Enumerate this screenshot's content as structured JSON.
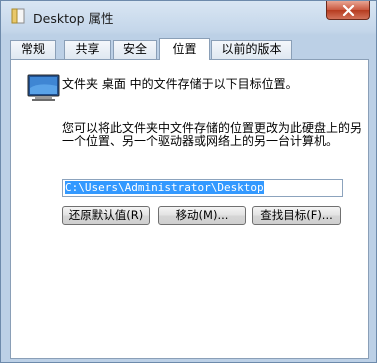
{
  "window": {
    "title": "Desktop 属性"
  },
  "tabs": [
    {
      "label": "常规"
    },
    {
      "label": "共享"
    },
    {
      "label": "安全"
    },
    {
      "label": "位置"
    },
    {
      "label": "以前的版本"
    }
  ],
  "location": {
    "description": "文件夹 桌面 中的文件存储于以下目标位置。",
    "explanation": "您可以将此文件夹中文件存储的位置更改为此硬盘上的另一个位置、另一个驱动器或网络上的另一台计算机。",
    "path_value": "C:\\Users\\Administrator\\Desktop"
  },
  "buttons": {
    "restore_default": "还原默认值(R)",
    "move": "移动(M)...",
    "find_target": "查找目标(F)..."
  },
  "icons": {
    "title": "folder-icon",
    "close": "close-icon",
    "location": "desktop-folder-icon"
  }
}
